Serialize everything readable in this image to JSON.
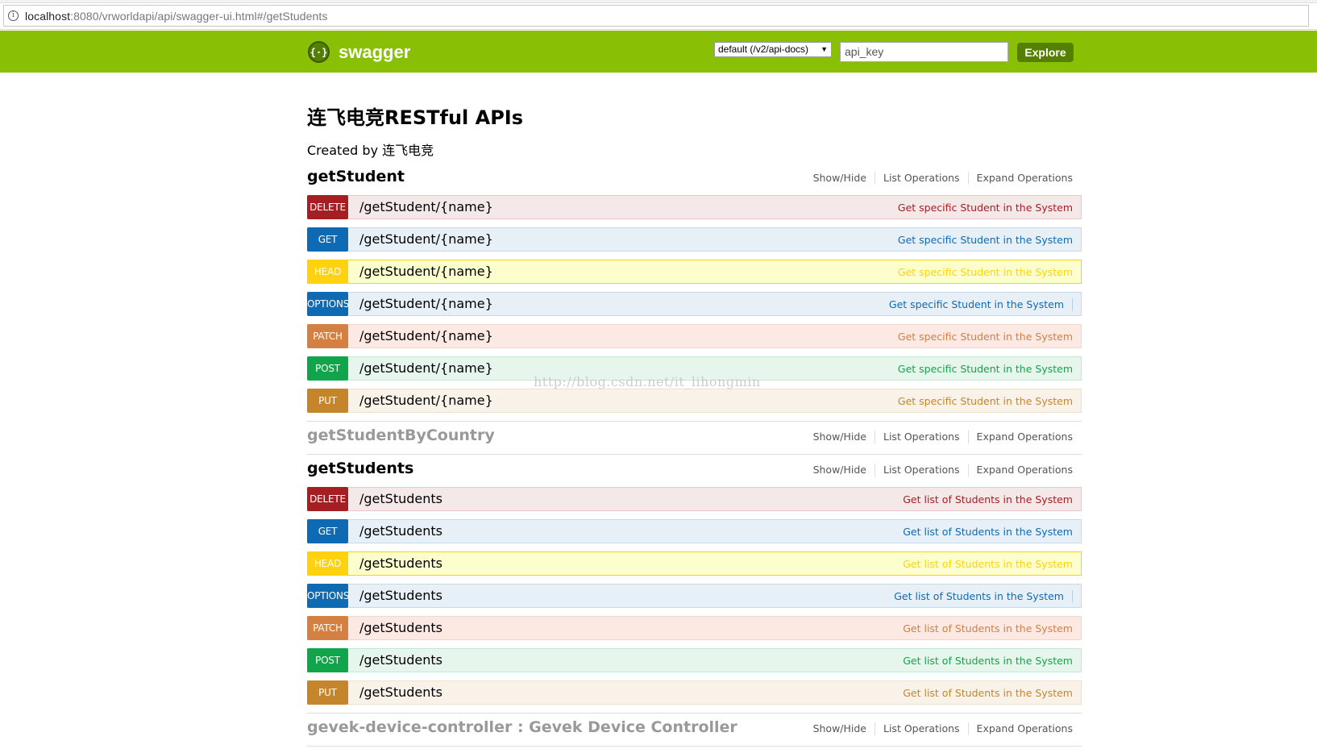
{
  "browser": {
    "url_host": "localhost",
    "url_rest": ":8080/vrworldapi/api/swagger-ui.html#/getStudents"
  },
  "header": {
    "logo_text": "swagger",
    "spec_select": "default (/v2/api-docs)",
    "api_key_placeholder": "api_key",
    "explore_label": "Explore"
  },
  "info": {
    "title": "连飞电竞RESTful APIs",
    "created_by": "Created by 连飞电竞"
  },
  "resource_links": {
    "show_hide": "Show/Hide",
    "list_ops": "List Operations",
    "expand_ops": "Expand Operations"
  },
  "resources": {
    "getStudent": {
      "name": "getStudent",
      "ops": [
        {
          "method": "DELETE",
          "path": "/getStudent/{name}",
          "summary": "Get specific Student in the System"
        },
        {
          "method": "GET",
          "path": "/getStudent/{name}",
          "summary": "Get specific Student in the System"
        },
        {
          "method": "HEAD",
          "path": "/getStudent/{name}",
          "summary": "Get specific Student in the System"
        },
        {
          "method": "OPTIONS",
          "path": "/getStudent/{name}",
          "summary": "Get specific Student in the System"
        },
        {
          "method": "PATCH",
          "path": "/getStudent/{name}",
          "summary": "Get specific Student in the System"
        },
        {
          "method": "POST",
          "path": "/getStudent/{name}",
          "summary": "Get specific Student in the System"
        },
        {
          "method": "PUT",
          "path": "/getStudent/{name}",
          "summary": "Get specific Student in the System"
        }
      ]
    },
    "getStudentByCountry": {
      "name": "getStudentByCountry"
    },
    "getStudents": {
      "name": "getStudents",
      "ops": [
        {
          "method": "DELETE",
          "path": "/getStudents",
          "summary": "Get list of Students in the System"
        },
        {
          "method": "GET",
          "path": "/getStudents",
          "summary": "Get list of Students in the System"
        },
        {
          "method": "HEAD",
          "path": "/getStudents",
          "summary": "Get list of Students in the System"
        },
        {
          "method": "OPTIONS",
          "path": "/getStudents",
          "summary": "Get list of Students in the System"
        },
        {
          "method": "PATCH",
          "path": "/getStudents",
          "summary": "Get list of Students in the System"
        },
        {
          "method": "POST",
          "path": "/getStudents",
          "summary": "Get list of Students in the System"
        },
        {
          "method": "PUT",
          "path": "/getStudents",
          "summary": "Get list of Students in the System"
        }
      ]
    },
    "gevek": {
      "name": "gevek-device-controller : Gevek Device Controller"
    }
  },
  "watermark": "http://blog.csdn.net/it_lihongmin"
}
